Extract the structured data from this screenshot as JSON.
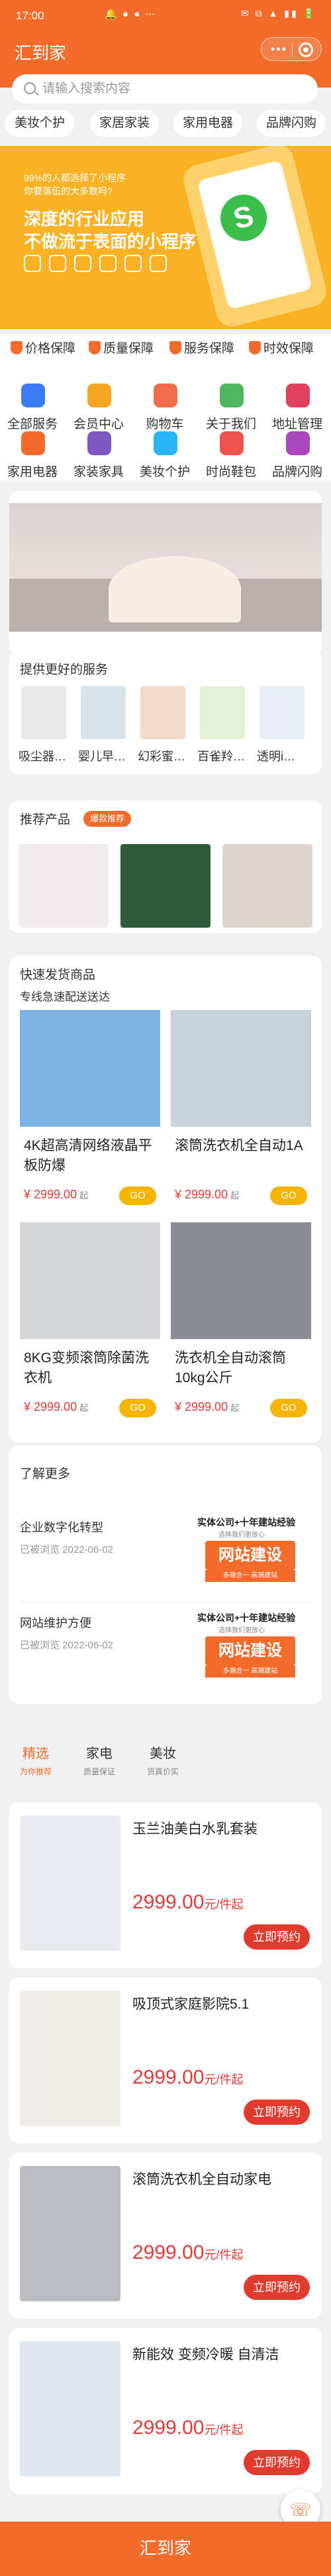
{
  "status": {
    "time": "17:00",
    "icons": "🔔 ● ● ⋯",
    "sys": "✉ ⧉ ▲ ▮▮ 🔋"
  },
  "nav": {
    "title": "汇到家",
    "capsule_dots": "•••"
  },
  "search": {
    "placeholder": "请输入搜索内容"
  },
  "categories": [
    "美妆个护",
    "家居家装",
    "家用电器",
    "品牌闪购"
  ],
  "banner": {
    "line1": "99%的人都选择了小程序",
    "line2": "你要落伍的大多数吗?",
    "line3": "深度的行业应用",
    "line4": "不做流于表面的小程序",
    "logo": "S"
  },
  "guarantees": [
    "价格保障",
    "质量保障",
    "服务保障",
    "时效保障"
  ],
  "grid": [
    {
      "label": "全部服务",
      "color": "#3a7cf5"
    },
    {
      "label": "会员中心",
      "color": "#f5a623"
    },
    {
      "label": "购物车",
      "color": "#f06c4a"
    },
    {
      "label": "关于我们",
      "color": "#4cb860"
    },
    {
      "label": "地址管理",
      "color": "#e2405f"
    },
    {
      "label": "家用电器",
      "color": "#f36b2a"
    },
    {
      "label": "家装家具",
      "color": "#7e57c2"
    },
    {
      "label": "美妆个护",
      "color": "#29b6f6"
    },
    {
      "label": "时尚鞋包",
      "color": "#ef5350"
    },
    {
      "label": "品牌闪购",
      "color": "#ab47bc"
    }
  ],
  "services": {
    "title": "提供更好的服务",
    "items": [
      "吸尘器…",
      "婴儿早…",
      "幻彩蜜…",
      "百雀羚…",
      "透明i…"
    ]
  },
  "recommend": {
    "title": "推荐产品",
    "badge": "爆款推荐"
  },
  "fast": {
    "title": "快速发货商品",
    "subtitle": "专线急速配送送达",
    "products": [
      {
        "name": "4K超高清网络液晶平板防爆",
        "price": "¥ 2999.00",
        "unit": "起",
        "btn": "GO"
      },
      {
        "name": "滚筒洗衣机全自动1A",
        "price": "¥ 2999.00",
        "unit": "起",
        "btn": "GO"
      },
      {
        "name": "8KG变频滚筒除菌洗衣机",
        "price": "¥ 2999.00",
        "unit": "起",
        "btn": "GO"
      },
      {
        "name": "洗衣机全自动滚筒10kg公斤",
        "price": "¥ 2999.00",
        "unit": "起",
        "btn": "GO"
      }
    ]
  },
  "more": {
    "title": "了解更多",
    "news": [
      {
        "title": "企业数字化转型",
        "date": "已被浏览 2022-06-02",
        "ad_head": "实体公司+十年建站经验",
        "ad_sub": "选择我们更放心",
        "ad_main": "网站建设",
        "ad_foot": "多端合一 高端建站"
      },
      {
        "title": "网站维护方便",
        "date": "已被浏览 2022-06-02",
        "ad_head": "实体公司+十年建站经验",
        "ad_sub": "选择我们更放心",
        "ad_main": "网站建设",
        "ad_foot": "多端合一 高端建站"
      }
    ]
  },
  "tabs": [
    {
      "label": "精选",
      "sub": "为你推荐"
    },
    {
      "label": "家电",
      "sub": "质量保证"
    },
    {
      "label": "美妆",
      "sub": "货真价实"
    }
  ],
  "list": [
    {
      "name": "玉兰油美白水乳套装",
      "price": "2999.00",
      "unit": "元/件起",
      "btn": "立即预约"
    },
    {
      "name": "吸顶式家庭影院5.1",
      "price": "2999.00",
      "unit": "元/件起",
      "btn": "立即预约"
    },
    {
      "name": "滚筒洗衣机全自动家电",
      "price": "2999.00",
      "unit": "元/件起",
      "btn": "立即预约"
    },
    {
      "name": "新能效 变频冷暖 自清洁",
      "price": "2999.00",
      "unit": "元/件起",
      "btn": "立即预约"
    }
  ],
  "tabbar": {
    "title": "汇到家"
  }
}
